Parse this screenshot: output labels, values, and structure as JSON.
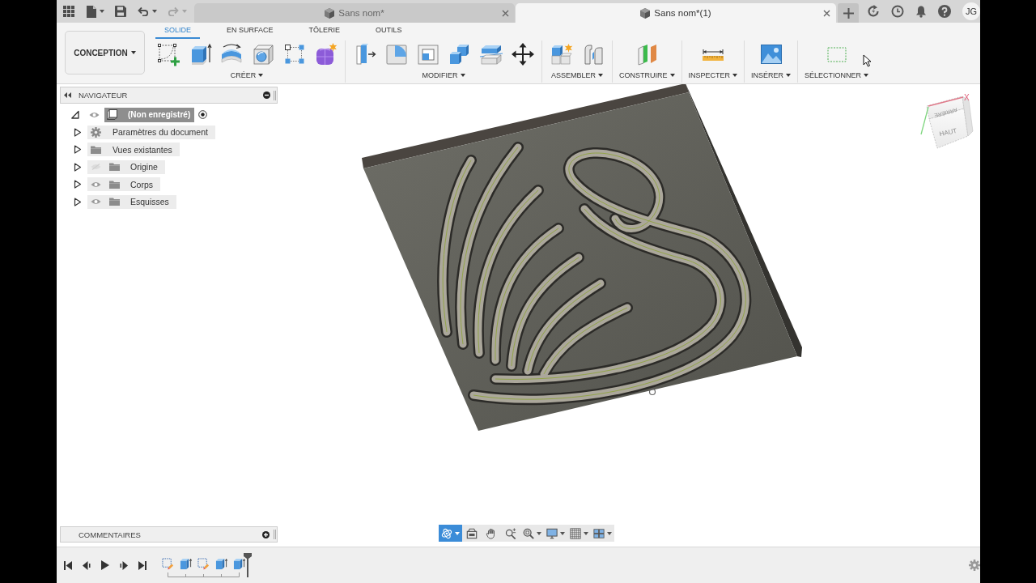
{
  "title_bar": {
    "quick_actions": [
      {
        "kind": "grid",
        "disabled": false
      },
      {
        "kind": "file",
        "disabled": false
      },
      {
        "kind": "save",
        "disabled": false
      },
      {
        "kind": "undo",
        "disabled": false
      },
      {
        "kind": "redo",
        "disabled": true
      }
    ],
    "document_tabs": [
      {
        "label": "Sans nom*",
        "selected": false
      },
      {
        "label": "Sans nom*(1)",
        "selected": true
      }
    ],
    "user_initials": "JG"
  },
  "toolbar": {
    "workspace": "CONCEPTION",
    "tabs": [
      {
        "label": "SOLIDE",
        "selected": true
      },
      {
        "label": "EN SURFACE",
        "selected": false
      },
      {
        "label": "TÔLERIE",
        "selected": false
      },
      {
        "label": "OUTILS",
        "selected": false
      }
    ],
    "groups": [
      {
        "label": "CRÉER",
        "tools": [
          {
            "kind": "sketch"
          },
          {
            "kind": "extrude"
          },
          {
            "kind": "revolve"
          },
          {
            "kind": "hole"
          },
          {
            "kind": "pattern"
          },
          {
            "kind": "form"
          }
        ]
      },
      {
        "label": "MODIFIER",
        "tools": [
          {
            "kind": "presspull"
          },
          {
            "kind": "fillet"
          },
          {
            "kind": "shell"
          },
          {
            "kind": "combine"
          },
          {
            "kind": "split"
          },
          {
            "kind": "move"
          }
        ]
      },
      {
        "label": "ASSEMBLER",
        "tools": [
          {
            "kind": "joint"
          },
          {
            "kind": "rigid"
          }
        ]
      },
      {
        "label": "CONSTRUIRE",
        "tools": [
          {
            "kind": "plane"
          }
        ]
      },
      {
        "label": "INSPECTER",
        "tools": [
          {
            "kind": "measure"
          }
        ]
      },
      {
        "label": "INSÉRER",
        "tools": [
          {
            "kind": "image"
          }
        ]
      },
      {
        "label": "SÉLECTIONNER",
        "tools": [
          {
            "kind": "select"
          }
        ]
      }
    ]
  },
  "navigator": {
    "title": "NAVIGATEUR",
    "tree": [
      {
        "label": "(Non enregistré)",
        "kind": "component",
        "selected": true,
        "expanded": true,
        "visible": true,
        "active": true,
        "children": [
          {
            "label": "Paramètres du document",
            "kind": "settings",
            "selected": false,
            "expanded": false
          },
          {
            "label": "Vues existantes",
            "kind": "folder",
            "selected": false,
            "expanded": false
          },
          {
            "label": "Origine",
            "kind": "folder",
            "selected": false,
            "expanded": false,
            "visible": false
          },
          {
            "label": "Corps",
            "kind": "folder",
            "selected": false,
            "expanded": false,
            "visible": true
          },
          {
            "label": "Esquisses",
            "kind": "folder",
            "selected": false,
            "expanded": false,
            "visible": true
          }
        ]
      }
    ]
  },
  "view_cube": {
    "faces": [
      "ARRIÈRE",
      "HAUT"
    ],
    "axis": "X"
  },
  "comments": {
    "title": "COMMENTAIRES"
  },
  "navigation_bar": {
    "tools": [
      {
        "kind": "orbit",
        "selected": true
      },
      {
        "kind": "look",
        "selected": false
      },
      {
        "kind": "pan",
        "selected": false
      },
      {
        "kind": "zoom",
        "selected": false
      },
      {
        "kind": "fit",
        "selected": false
      },
      {
        "kind": "display",
        "selected": false
      },
      {
        "kind": "grid",
        "selected": false
      },
      {
        "kind": "viewports",
        "selected": false
      }
    ]
  },
  "timeline": {
    "features": [
      {
        "kind": "sketch"
      },
      {
        "kind": "extrude"
      },
      {
        "kind": "sketch"
      },
      {
        "kind": "extrude"
      },
      {
        "kind": "extrude"
      }
    ]
  }
}
